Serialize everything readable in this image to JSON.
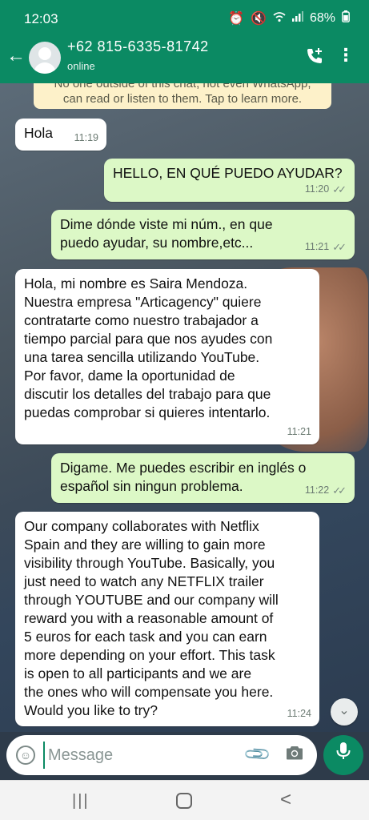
{
  "status_bar": {
    "time": "12:03",
    "battery": "68%"
  },
  "header": {
    "contact": "+62 815-6335-81742",
    "status": "online"
  },
  "notice": {
    "text": "No one outside of this chat, not even WhatsApp,\ncan read or listen to them. Tap to learn more."
  },
  "messages": [
    {
      "dir": "in",
      "text": "Hola",
      "time": "11:19"
    },
    {
      "dir": "out",
      "text": "HELLO, EN QUÉ PUEDO AYUDAR?",
      "time": "11:20"
    },
    {
      "dir": "out",
      "text": "Dime dónde viste mi núm., en que\npuedo ayudar, su nombre,etc...",
      "time": "11:21"
    },
    {
      "dir": "in",
      "text": "Hola, mi nombre es Saira Mendoza.\nNuestra empresa \"Articagency\" quiere\ncontratarte como nuestro trabajador a\ntiempo parcial para que nos ayudes con\nuna tarea sencilla utilizando YouTube.\nPor favor, dame la oportunidad de\ndiscutir los detalles del trabajo para que\npuedas comprobar si quieres intentarlo.",
      "time": "11:21"
    },
    {
      "dir": "out",
      "text": "Digame. Me puedes escribir en inglés  o\nespañol sin ningun problema.",
      "time": "11:22"
    },
    {
      "dir": "in",
      "text": "Our company collaborates with Netflix\nSpain and they are willing to gain more\nvisibility through YouTube. Basically, you\njust need to watch any NETFLIX trailer\nthrough YOUTUBE and our company will\nreward you with a reasonable amount of\n5 euros for each task and you can earn\nmore depending on your effort. This task\nis open to all participants and we are\nthe ones who will compensate you here.\nWould you like to try?",
      "time": "11:24"
    }
  ],
  "composer": {
    "placeholder": "Message"
  },
  "icons": {
    "back": "arrow-left-icon",
    "call": "add-call-icon",
    "menu": "kebab-menu-icon",
    "emoji": "emoji-icon",
    "attach": "paperclip-icon",
    "camera": "camera-icon",
    "mic": "microphone-icon",
    "read_receipt": "double-check-icon",
    "scroll": "chevron-double-down-icon"
  },
  "colors": {
    "brand": "#0b8a63",
    "outgoing_bubble": "#dcf8c6",
    "incoming_bubble": "#ffffff",
    "notice_bg": "#fdf1c9"
  }
}
